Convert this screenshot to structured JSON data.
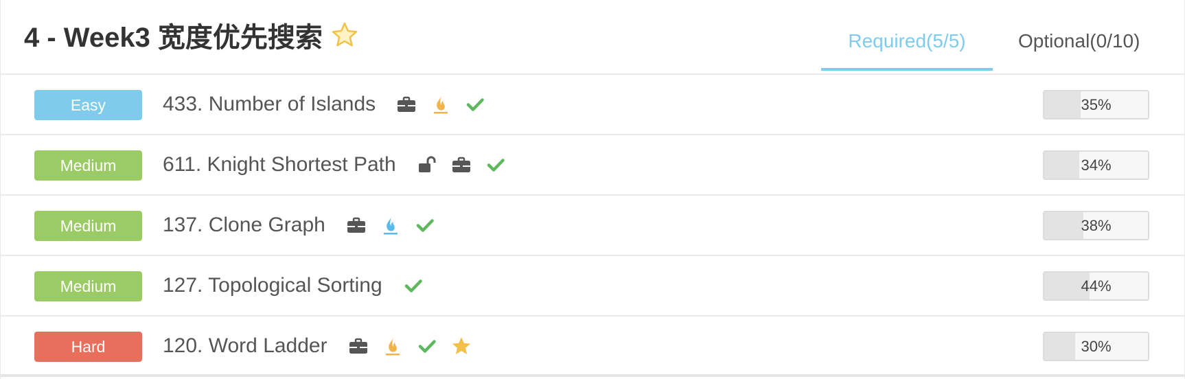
{
  "header": {
    "title": "4 - Week3 宽度优先搜索",
    "title_icon": "star-outline-icon"
  },
  "tabs": [
    {
      "label": "Required(5/5)",
      "active": true
    },
    {
      "label": "Optional(0/10)",
      "active": false
    }
  ],
  "colors": {
    "accent": "#7ecbec",
    "easy": "#7ecbec",
    "medium": "#9bcb65",
    "hard": "#e86f5c",
    "check": "#5fb85f",
    "fire_orange": "#f0b44b",
    "fire_blue": "#5bbbe8",
    "star_gold": "#f4c04c",
    "briefcase": "#555555"
  },
  "problems": [
    {
      "difficulty": "Easy",
      "title": "433. Number of Islands",
      "icons": [
        "briefcase-icon",
        "fire-orange-icon",
        "check-icon"
      ],
      "progress": "35%",
      "progress_value": 0.35
    },
    {
      "difficulty": "Medium",
      "title": "611. Knight Shortest Path",
      "icons": [
        "unlock-icon",
        "briefcase-icon",
        "check-icon"
      ],
      "progress": "34%",
      "progress_value": 0.34
    },
    {
      "difficulty": "Medium",
      "title": "137. Clone Graph",
      "icons": [
        "briefcase-icon",
        "fire-blue-icon",
        "check-icon"
      ],
      "progress": "38%",
      "progress_value": 0.38
    },
    {
      "difficulty": "Medium",
      "title": "127. Topological Sorting",
      "icons": [
        "check-icon"
      ],
      "progress": "44%",
      "progress_value": 0.44
    },
    {
      "difficulty": "Hard",
      "title": "120. Word Ladder",
      "icons": [
        "briefcase-icon",
        "fire-orange-icon",
        "check-icon",
        "star-icon"
      ],
      "progress": "30%",
      "progress_value": 0.3
    }
  ]
}
